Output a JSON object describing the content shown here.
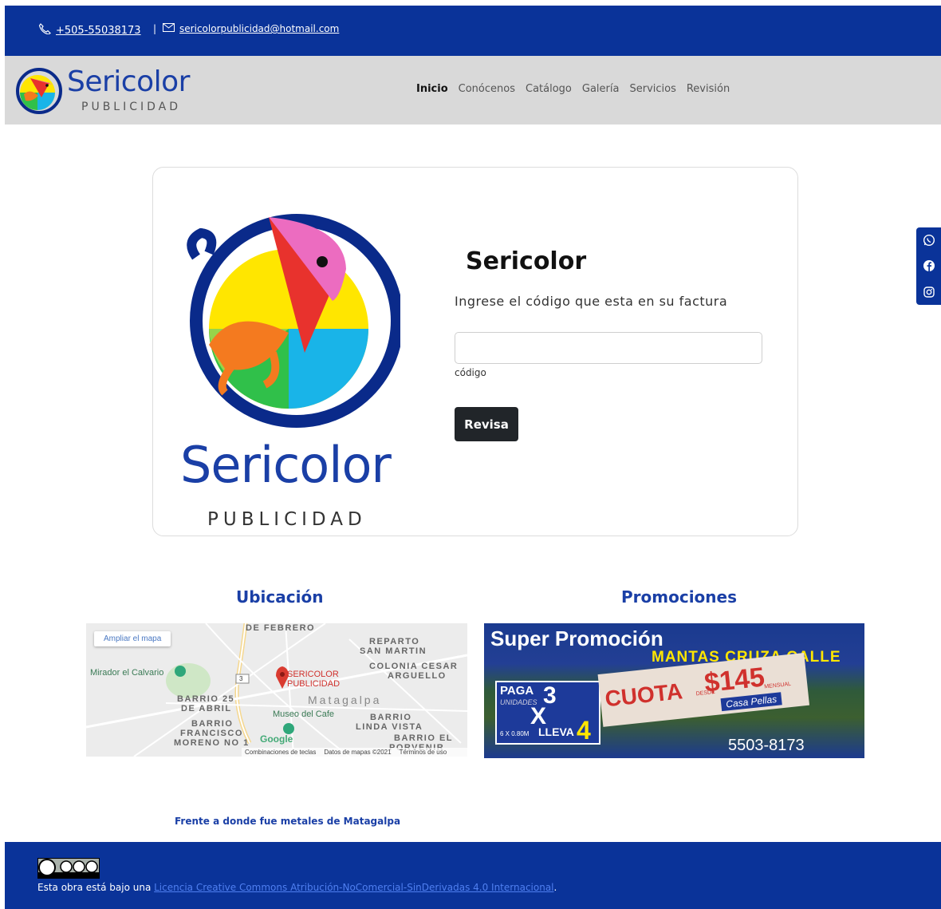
{
  "topbar": {
    "phone": "+505-55038173",
    "separator": "|",
    "email": "sericolorpublicidad@hotmail.com",
    "phone_icon": "phone-icon",
    "email_icon": "envelope-icon"
  },
  "brand": {
    "name": "Sericolor",
    "subtitle": "PUBLICIDAD"
  },
  "nav": {
    "items": [
      {
        "label": "Inicio"
      },
      {
        "label": "Conócenos"
      },
      {
        "label": "Catálogo"
      },
      {
        "label": "Galería"
      },
      {
        "label": "Servicios"
      },
      {
        "label": "Revisión"
      }
    ],
    "active": "Inicio"
  },
  "social": {
    "icons": [
      "whatsapp-icon",
      "facebook-icon",
      "instagram-icon"
    ]
  },
  "card": {
    "logo_name": "Sericolor",
    "logo_sub": "PUBLICIDAD",
    "title": "Sericolor",
    "instruction": "Ingrese el código que esta en su factura",
    "input_value": "",
    "field_label": "código",
    "button": "Revisa"
  },
  "ubicacion": {
    "title": "Ubicación",
    "map": {
      "ampliar": "Ampliar el mapa",
      "labels": {
        "feb": "DE FEBRERO",
        "reparto_1": "REPARTO",
        "reparto_2": "SAN MARTIN",
        "colonia_1": "COLONIA CESAR",
        "colonia_2": "ARGUELLO",
        "mirador": "Mirador el Calvario",
        "route": "3",
        "poi_1": "SERICOLOR",
        "poi_2": "PUBLICIDAD",
        "barrio25_1": "BARRIO 25",
        "barrio25_2": "DE ABRIL",
        "matagalpa": "Matagalpa",
        "museo": "Museo del Cafe",
        "linda_1": "BARRIO",
        "linda_2": "LINDA VISTA",
        "francisco_1": "BARRIO",
        "francisco_2": "FRANCISCO",
        "francisco_3": "MORENO NO 1",
        "porvenir_1": "BARRIO EL",
        "porvenir_2": "PORVENIR",
        "google": "Google"
      },
      "attribution": [
        "Combinaciones de teclas",
        "Datos de mapas ©2021",
        "Términos de uso"
      ]
    }
  },
  "promociones": {
    "title": "Promociones",
    "banner": {
      "headline": "Super Promoción",
      "subline": "MANTAS CRUZA CALLE",
      "paga": "PAGA",
      "paga_num": "3",
      "unidades": "UNIDADES",
      "x": "X",
      "size": "6 X 0.80M",
      "lleva": "LLEVA",
      "lleva_num": "4",
      "cuota": "CUOTA",
      "desde": "DESDE",
      "price": "$145",
      "mensual": "MENSUAL",
      "brand": "Casa Pellas",
      "phone": "5503-8173"
    }
  },
  "address": "Frente a donde fue metales de Matagalpa",
  "footer": {
    "prefix": "Esta obra está bajo una ",
    "license_link": "Licencia Creative Commons Atribución-NoComercial-SinDerivadas 4.0 Internacional",
    "suffix": ".",
    "cc_badge": "cc-by-nc-nd-icon"
  },
  "colors": {
    "primary_blue": "#0a3399",
    "brand_blue": "#1a3fa6",
    "nav_bg": "#d9d9d9",
    "button_dark": "#212529"
  }
}
